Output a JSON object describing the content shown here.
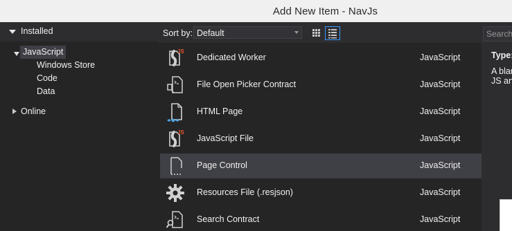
{
  "window": {
    "title": "Add New Item - NavJs"
  },
  "tree": {
    "installed": "Installed",
    "items": [
      {
        "label": "JavaScript"
      },
      {
        "label": "Windows Store"
      },
      {
        "label": "Code"
      },
      {
        "label": "Data"
      }
    ],
    "online": "Online"
  },
  "sort": {
    "label": "Sort by:",
    "value": "Default"
  },
  "templates": [
    {
      "name": "Dedicated Worker",
      "lang": "JavaScript",
      "icon": "js-file-icon"
    },
    {
      "name": "File Open Picker Contract",
      "lang": "JavaScript",
      "icon": "contract-file-icon"
    },
    {
      "name": "HTML Page",
      "lang": "JavaScript",
      "icon": "html-page-icon"
    },
    {
      "name": "JavaScript File",
      "lang": "JavaScript",
      "icon": "js-file-icon"
    },
    {
      "name": "Page Control",
      "lang": "JavaScript",
      "icon": "page-control-icon"
    },
    {
      "name": "Resources File (.resjson)",
      "lang": "JavaScript",
      "icon": "gear-icon"
    },
    {
      "name": "Search Contract",
      "lang": "JavaScript",
      "icon": "search-contract-icon"
    }
  ],
  "details": {
    "search_placeholder": "Search",
    "type_label": "Type:",
    "desc_line1": "A blar",
    "desc_line2": "JS anc"
  },
  "colors": {
    "accent": "#3399ff",
    "js_badge": "#e8552d",
    "selected_row": "#3f3f46"
  }
}
